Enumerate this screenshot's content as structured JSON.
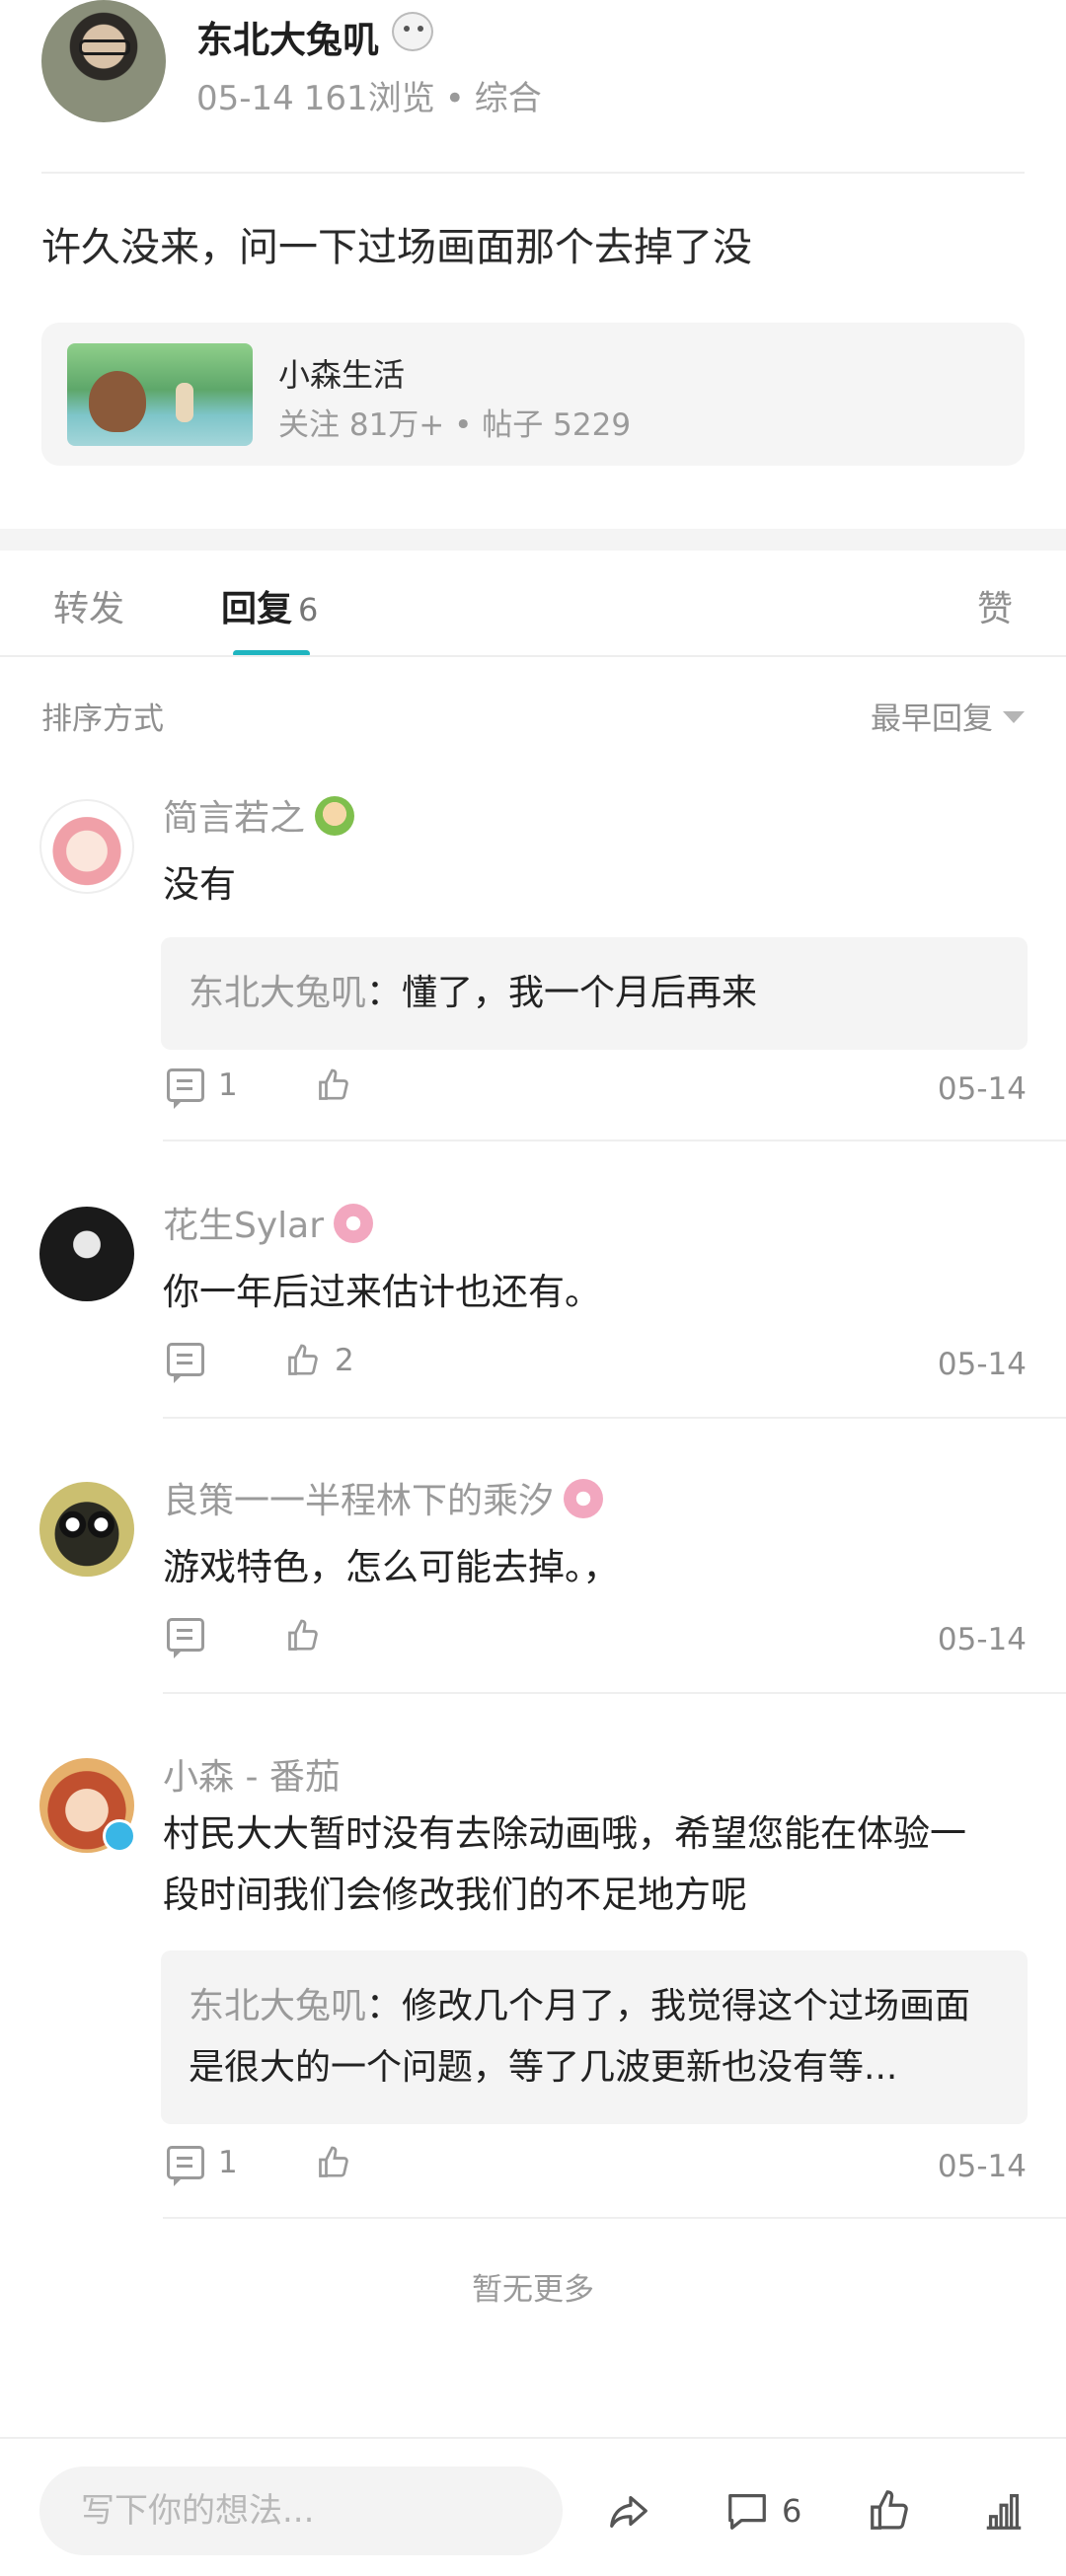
{
  "post": {
    "author": "东北大兔叽",
    "date": "05-14",
    "views": "161浏览",
    "separator": "•",
    "category": "综合",
    "content": "许久没来，问一下过场画面那个去掉了没"
  },
  "forum": {
    "name": "小森生活",
    "followers": "关注 81万+",
    "separator": "•",
    "posts": "帖子 5229"
  },
  "tabs": {
    "forward": "转发",
    "reply": "回复",
    "reply_count": "6",
    "like": "赞"
  },
  "sort": {
    "label": "排序方式",
    "selected": "最早回复"
  },
  "comments": [
    {
      "name": "简言若之",
      "text": "没有",
      "quote_author": "东北大兔叽",
      "quote_text": "懂了，我一个月后再来",
      "reply_count": "1",
      "like_count": "",
      "date": "05-14"
    },
    {
      "name": "花生Sylar",
      "text": "你一年后过来估计也还有。",
      "reply_count": "",
      "like_count": "2",
      "date": "05-14"
    },
    {
      "name": "良策一一半程林下的乘汐",
      "text": "游戏特色，怎么可能去掉。，",
      "reply_count": "",
      "like_count": "",
      "date": "05-14"
    },
    {
      "name": "小森 - 番茄",
      "text": "村民大大暂时没有去除动画哦，希望您能在体验一段时间我们会修改我们的不足地方呢",
      "quote_author": "东北大兔叽",
      "quote_text": "修改几个月了，我觉得这个过场画面是很大的一个问题，等了几波更新也没有等...",
      "reply_count": "1",
      "like_count": "",
      "date": "05-14"
    }
  ],
  "no_more": "暂无更多",
  "bottom_bar": {
    "input_placeholder": "写下你的想法...",
    "comment_count": "6"
  },
  "colors": {
    "accent": "#1fb5c0",
    "muted_text": "#9a9a9a",
    "quote_bg": "#f4f4f4"
  },
  "icons": [
    "comment-icon",
    "like-icon",
    "share-icon",
    "stats-icon",
    "caret-down-icon"
  ]
}
